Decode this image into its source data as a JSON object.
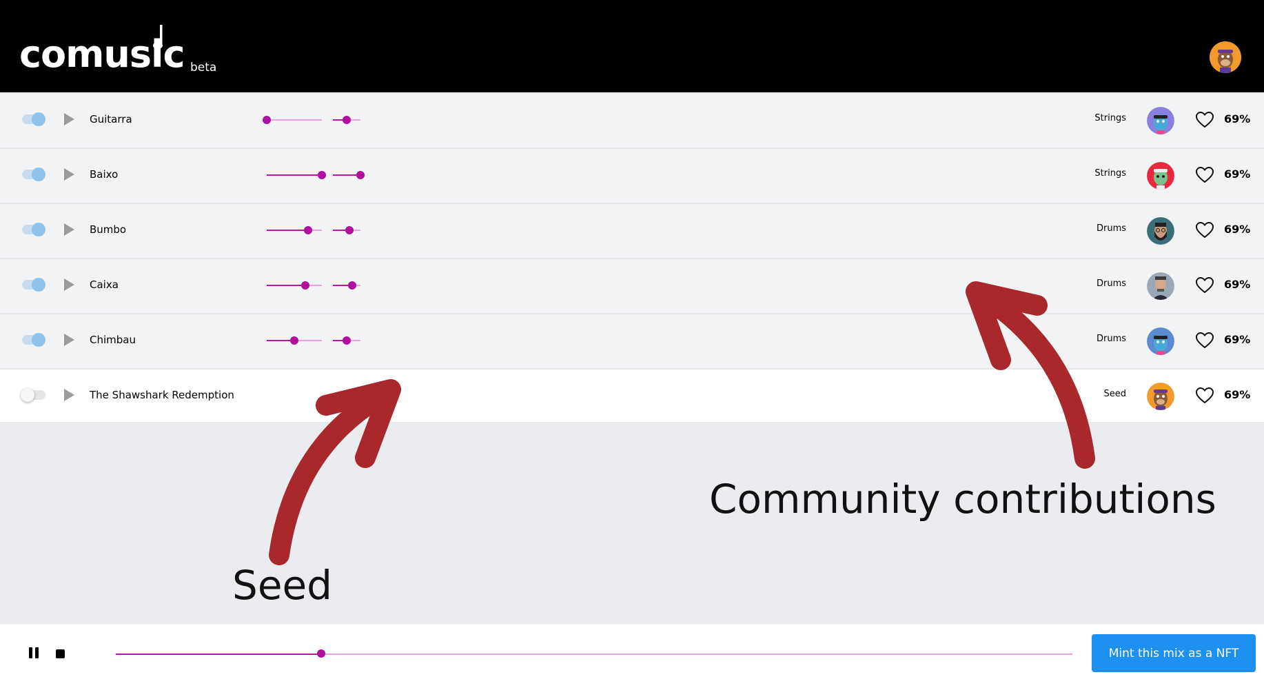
{
  "app": {
    "logo_text": "comusic",
    "badge": "beta",
    "accent": "#b5179e",
    "header_bg": "#000000"
  },
  "tracks": [
    {
      "name": "Guitarra",
      "enabled": true,
      "volume": 0,
      "pan": 0.5,
      "category": "Strings",
      "avatar_icon": "blue-ape-avatar-icon",
      "avatar_color": "#8a7fe0",
      "percent": "69%"
    },
    {
      "name": "Baixo",
      "enabled": true,
      "volume": 1.0,
      "pan": 1.0,
      "category": "Strings",
      "avatar_icon": "green-ape-avatar-icon",
      "avatar_color": "#e8283c",
      "percent": "69%"
    },
    {
      "name": "Bumbo",
      "enabled": true,
      "volume": 0.75,
      "pan": 0.6,
      "category": "Drums",
      "avatar_icon": "bearded-man-avatar-icon",
      "avatar_color": "#3a6e78",
      "percent": "69%"
    },
    {
      "name": "Caixa",
      "enabled": true,
      "volume": 0.7,
      "pan": 0.7,
      "category": "Drums",
      "avatar_icon": "man-photo-avatar-icon",
      "avatar_color": "#9aa8b8",
      "percent": "69%"
    },
    {
      "name": "Chimbau",
      "enabled": true,
      "volume": 0.5,
      "pan": 0.5,
      "category": "Drums",
      "avatar_icon": "blue-ape-avatar-icon",
      "avatar_color": "#5a8ad0",
      "percent": "69%"
    },
    {
      "name": "The Shawshark Redemption",
      "enabled": false,
      "volume": null,
      "pan": null,
      "category": "Seed",
      "avatar_icon": "orange-ape-avatar-icon",
      "avatar_color": "#f39a2e",
      "percent": "69%"
    }
  ],
  "annotations": {
    "seed": "Seed",
    "community": "Community contributions",
    "arrow_color": "#a8282c"
  },
  "player": {
    "progress": 0.215,
    "mint_label": "Mint this mix as a NFT",
    "mint_color": "#1e90f0"
  }
}
